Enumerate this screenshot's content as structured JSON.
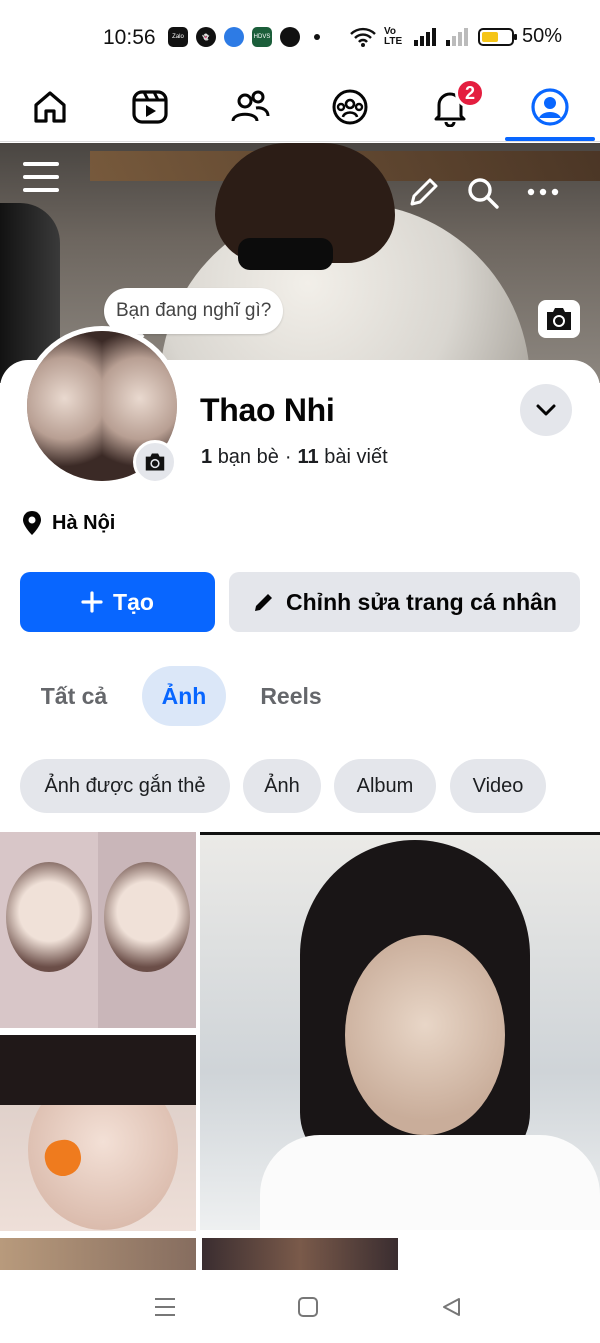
{
  "status_bar": {
    "time": "10:56",
    "apps": [
      "Zalo",
      "Snapchat",
      "Messenger Lite",
      "HDVS",
      "Browser"
    ],
    "network": "Vo LTE",
    "battery": "50%"
  },
  "nav": {
    "tabs": [
      "Home",
      "Video",
      "Friends",
      "Groups",
      "Notifications",
      "Profile"
    ],
    "notification_count": "2",
    "active_tab": "Profile",
    "accent": "#0866ff"
  },
  "cover": {
    "status_prompt": "Bạn đang nghĩ gì?"
  },
  "profile": {
    "name": "Thao Nhi",
    "friends_count": "1",
    "friends_label": "bạn bè",
    "posts_count": "11",
    "posts_label": "bài viết",
    "location": "Hà Nội"
  },
  "actions": {
    "create_label": "Tạo",
    "edit_label": "Chỉnh sửa trang cá nhân"
  },
  "tabs": {
    "all": "Tất cả",
    "photos": "Ảnh",
    "reels": "Reels",
    "active": "Ảnh"
  },
  "filters": {
    "tagged": "Ảnh được gắn thẻ",
    "photos": "Ảnh",
    "album": "Album",
    "video": "Video"
  }
}
